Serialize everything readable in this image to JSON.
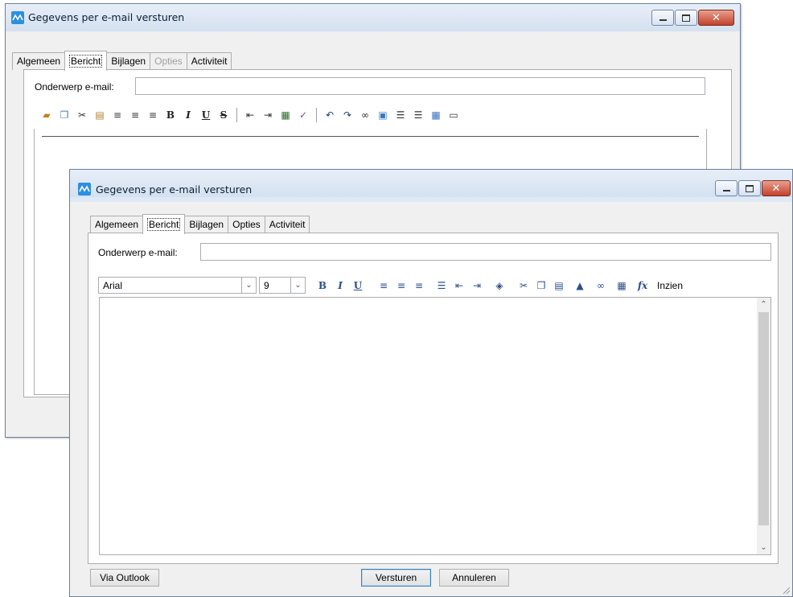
{
  "windows": [
    {
      "title": "Gegevens per e-mail versturen",
      "tabs": [
        {
          "label": "Algemeen",
          "state": "normal"
        },
        {
          "label": "Bericht",
          "state": "active"
        },
        {
          "label": "Bijlagen",
          "state": "normal"
        },
        {
          "label": "Opties",
          "state": "disabled"
        },
        {
          "label": "Activiteit",
          "state": "normal"
        }
      ],
      "subject_label": "Onderwerp e-mail:",
      "subject_value": ""
    },
    {
      "title": "Gegevens per e-mail versturen",
      "tabs": [
        {
          "label": "Algemeen",
          "state": "normal"
        },
        {
          "label": "Bericht",
          "state": "active"
        },
        {
          "label": "Bijlagen",
          "state": "normal"
        },
        {
          "label": "Opties",
          "state": "normal"
        },
        {
          "label": "Activiteit",
          "state": "normal"
        }
      ],
      "subject_label": "Onderwerp e-mail:",
      "subject_value": "",
      "font_name": "Arial",
      "font_size": "9",
      "insert_label": "Inzien",
      "buttons": {
        "via_outlook": "Via Outlook",
        "send": "Versturen",
        "cancel": "Annuleren"
      }
    }
  ],
  "colors": {
    "title_bg": "#dfe9f5",
    "close_red": "#c3412b",
    "app_icon_blue": "#2b8fe0"
  }
}
